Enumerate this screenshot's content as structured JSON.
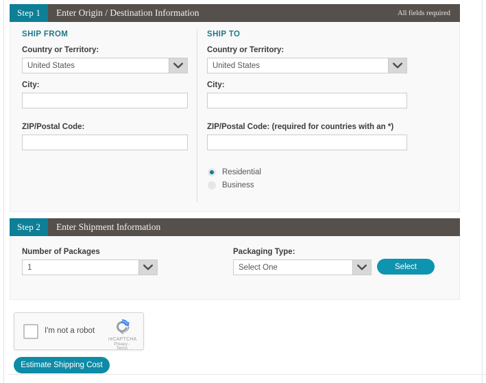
{
  "step1": {
    "badge": "Step 1",
    "title": "Enter Origin / Destination Information",
    "note": "All fields required",
    "ship_from": {
      "heading": "SHIP FROM",
      "country_label": "Country or Territory:",
      "country_value": "United States",
      "city_label": "City:",
      "city_value": "",
      "city_placeholder": "",
      "zip_label": "ZIP/Postal Code:",
      "zip_value": "",
      "zip_placeholder": ""
    },
    "ship_to": {
      "heading": "SHIP TO",
      "country_label": "Country or Territory:",
      "country_value": "United States",
      "city_label": "City:",
      "city_value": "",
      "city_placeholder": "",
      "zip_label": "ZIP/Postal Code: (required for countries with an *)",
      "zip_value": "",
      "zip_placeholder": "",
      "address_type": {
        "residential_label": "Residential",
        "business_label": "Business",
        "selected": "Residential"
      }
    }
  },
  "step2": {
    "badge": "Step 2",
    "title": "Enter Shipment Information",
    "packages_label": "Number of Packages",
    "packages_value": "1",
    "packaging_label": "Packaging Type:",
    "packaging_value": "Select One",
    "select_button": "Select"
  },
  "captcha": {
    "checkbox_label": "I'm not a robot",
    "brand": "reCAPTCHA",
    "links": "Privacy - Terms"
  },
  "submit": {
    "label": "Estimate Shipping Cost"
  },
  "colors": {
    "teal": "#0d7f96",
    "teal_button": "#0e94b0",
    "header_dark": "#56504d",
    "heading_text": "#20798a",
    "panel_bg": "#f9f9f9"
  },
  "icons": {
    "chevron": "chevron-down-icon",
    "recaptcha": "recaptcha-logo-icon"
  }
}
